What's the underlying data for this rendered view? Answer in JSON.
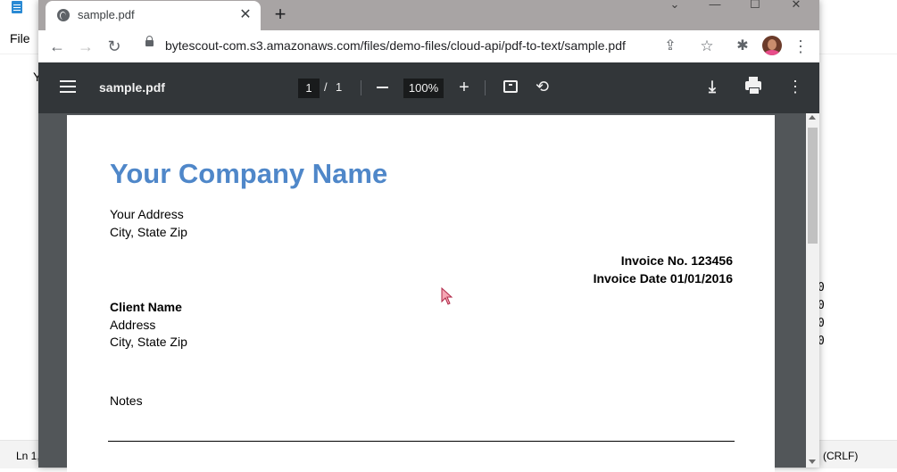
{
  "notepad": {
    "menu_file": "File",
    "text_fragment": "Y",
    "right_fragment": "0\n0\n0\n0",
    "status_left": "Ln 1,",
    "status_right": "(CRLF)"
  },
  "browser": {
    "tab": {
      "title": "sample.pdf",
      "close": "✕"
    },
    "new_tab": "+",
    "window_controls": {
      "dropdown": "⌄",
      "minimize": "—",
      "maximize": "☐",
      "close": "✕"
    },
    "toolbar": {
      "back": "←",
      "forward": "→",
      "reload": "↻",
      "url": "bytescout-com.s3.amazonaws.com/files/demo-files/cloud-api/pdf-to-text/sample.pdf",
      "share": "⇪",
      "star": "☆",
      "extensions": "✱",
      "menu": "⋮"
    }
  },
  "pdf_viewer": {
    "file_title": "sample.pdf",
    "page_current": "1",
    "page_separator": "/",
    "page_total": "1",
    "zoom": "100%",
    "zoom_in": "+",
    "rotate": "⟲",
    "download": "⤓",
    "more": "⋮"
  },
  "document": {
    "company_name": "Your Company Name",
    "address_line1": "Your Address",
    "address_line2": "City, State Zip",
    "invoice_number": "Invoice No. 123456",
    "invoice_date": "Invoice Date 01/01/2016",
    "client_name": "Client Name",
    "client_address": "Address",
    "client_city": "City, State Zip",
    "notes_label": "Notes"
  },
  "colors": {
    "company_blue": "#4f87c9",
    "viewer_bar": "#323639",
    "viewer_bg": "#525659",
    "tabstrip": "#a8a4a4"
  }
}
